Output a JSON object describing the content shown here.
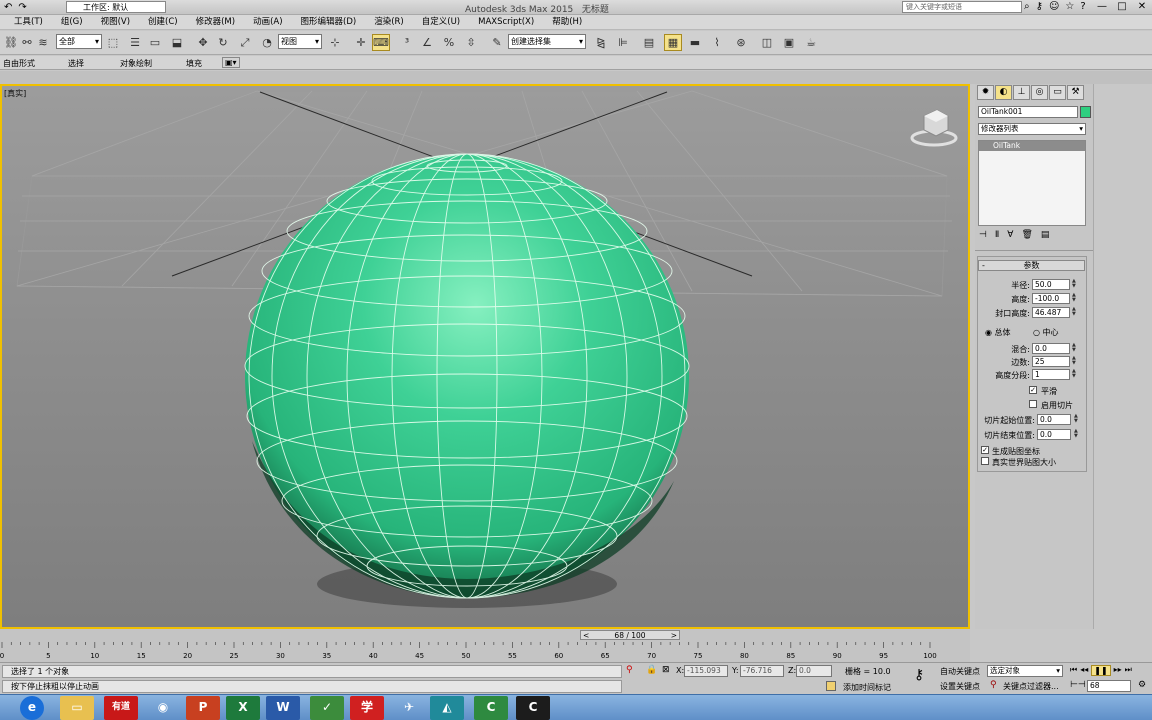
{
  "titlebar": {
    "workspace": "工作区: 默认",
    "title": "Autodesk 3ds Max  2015",
    "doc": "无标题",
    "search_placeholder": "键入关键字或短语"
  },
  "menu": [
    "工具(T)",
    "组(G)",
    "视图(V)",
    "创建(C)",
    "修改器(M)",
    "动画(A)",
    "图形编辑器(D)",
    "渲染(R)",
    "自定义(U)",
    "MAXScript(X)",
    "帮助(H)"
  ],
  "toolbar": {
    "filter": "全部",
    "ref_coord": "视图",
    "named_sel": "创建选择集"
  },
  "ribbon": [
    "自由形式",
    "选择",
    "对象绘制",
    "填充"
  ],
  "viewport": {
    "label": "[真实]"
  },
  "command_panel": {
    "object_name": "OilTank001",
    "object_color": "#2fcf80",
    "modifier_list": "修改器列表",
    "stack_item": "OilTank",
    "rollout_title": "参数",
    "params": [
      {
        "label": "半径:",
        "value": "50.0"
      },
      {
        "label": "高度:",
        "value": "-100.0"
      },
      {
        "label": "封口高度:",
        "value": "46.487"
      }
    ],
    "radio_overall": "总体",
    "radio_center": "中心",
    "params2": [
      {
        "label": "混合:",
        "value": "0.0"
      },
      {
        "label": "边数:",
        "value": "25"
      },
      {
        "label": "高度分段:",
        "value": "1"
      }
    ],
    "smooth_label": "平滑",
    "slice_on_label": "启用切片",
    "slice_from_label": "切片起始位置:",
    "slice_from": "0.0",
    "slice_to_label": "切片结束位置:",
    "slice_to": "0.0",
    "gen_map_label": "生成贴图坐标",
    "real_world_label": "真实世界贴图大小"
  },
  "timeline": {
    "frame": "68 / 100",
    "ticks": [
      "0",
      "5",
      "10",
      "15",
      "20",
      "25",
      "30",
      "35",
      "40",
      "45",
      "50",
      "55",
      "60",
      "65",
      "70",
      "75",
      "80",
      "85",
      "90",
      "95",
      "100"
    ]
  },
  "status": {
    "selected": "选择了 1 个对象",
    "prompt": "按下停止抹粗以停止动画",
    "x_label": "X:",
    "x": "-115.093",
    "y_label": "Y:",
    "y": "-76.716",
    "z_label": "Z:",
    "z": "0.0",
    "grid": "栅格 = 10.0",
    "add_time_tag": "添加时间标记",
    "auto_key": "自动关键点",
    "sel_obj": "选定对象",
    "set_key": "设置关键点",
    "key_filter": "关键点过滤器...",
    "frame_field": "68"
  },
  "taskbar": [
    "e",
    "",
    "◉",
    "P",
    "X",
    "W",
    "✓",
    "有道",
    "学",
    "✈",
    "",
    "C",
    "C"
  ]
}
